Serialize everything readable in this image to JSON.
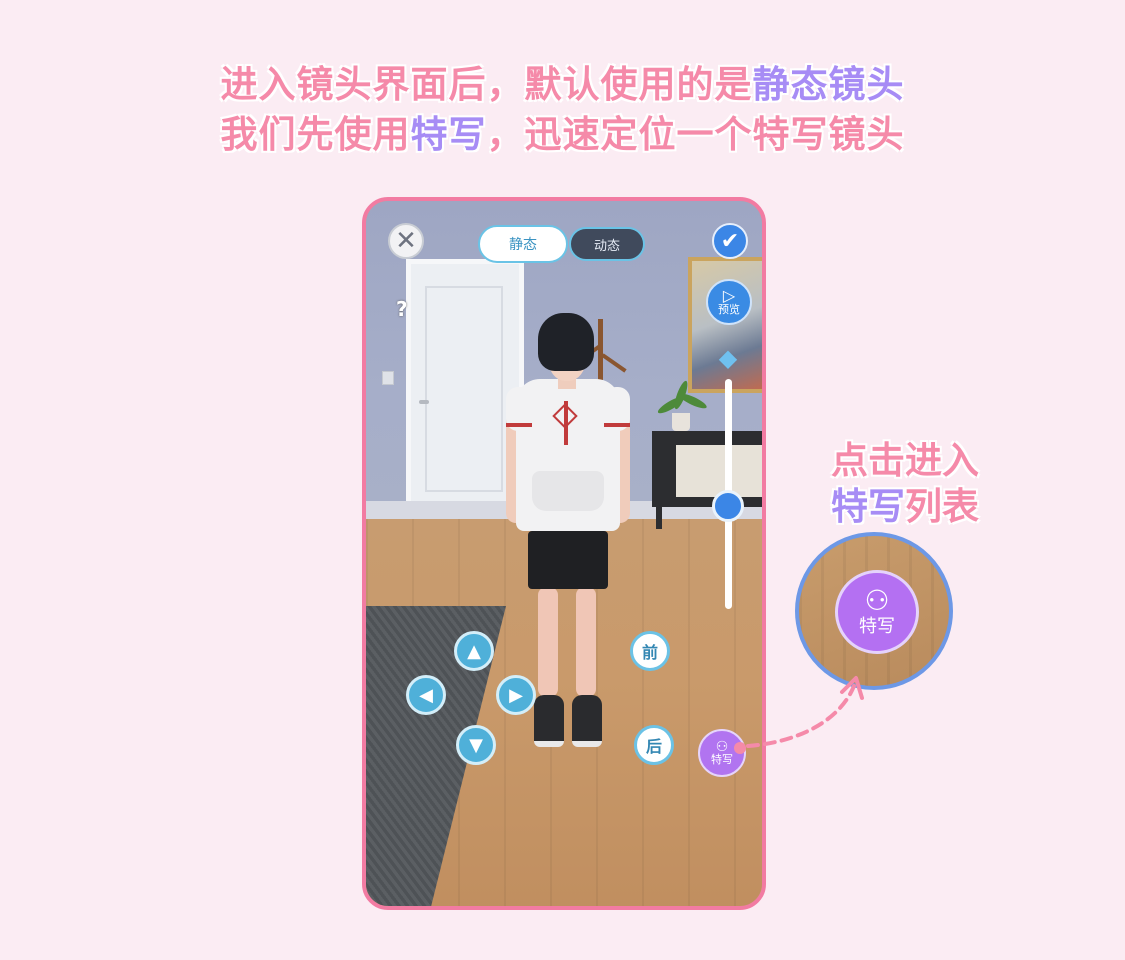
{
  "instruction": {
    "line1_pre": "进入镜头界面后，默认使用的是",
    "line1_highlight": "静态镜头",
    "line2_pre": "我们先使用",
    "line2_highlight": "特写",
    "line2_post": "，迅速定位一个特写镜头"
  },
  "phone": {
    "close_icon": "✕",
    "check_icon": "✔",
    "help_icon": "?",
    "mode_tabs": {
      "static": "静态",
      "dynamic": "动态"
    },
    "preview": {
      "icon": "▷",
      "label": "预览"
    },
    "cube_icon": "◆",
    "camera_slider_level": 0.55,
    "arrows": {
      "up": "▲",
      "left": "◀",
      "right": "▶",
      "down": "▼"
    },
    "front_label": "前",
    "back_label": "后",
    "closeup": {
      "icon": "⚇",
      "label": "特写"
    }
  },
  "callout": {
    "line1": "点击进入",
    "line2_highlight": "特写",
    "line2_post": "列表",
    "zoom_button": {
      "icon": "⚇",
      "label": "特写"
    }
  },
  "colors": {
    "accent_pink": "#f58aa9",
    "accent_purple": "#a78cf5",
    "phone_border": "#f27ba2",
    "closeup_purple": "#b174f0",
    "primary_blue": "#3b86e6"
  }
}
